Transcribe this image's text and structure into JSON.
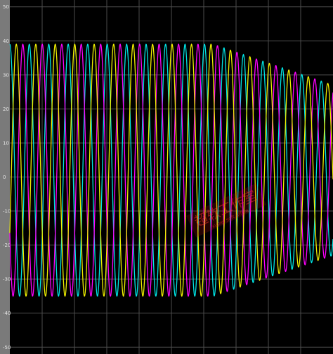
{
  "chart_data": {
    "type": "line",
    "title": "",
    "xlabel": "",
    "ylabel": "",
    "ylim": [
      -52,
      52
    ],
    "yticks": [
      -50,
      -40,
      -30,
      -20,
      -10,
      0,
      10,
      20,
      30,
      40,
      50
    ],
    "ytick_labels": [
      "-50",
      "-40",
      "-30",
      "-20",
      "-10",
      "0",
      "10",
      "20",
      "30",
      "40",
      "50"
    ],
    "grid": true,
    "background": "#000000",
    "grid_color": "#4d4d4d",
    "axis_color": "#a6a6a6",
    "cycles_visible": 16.6,
    "series": [
      {
        "color": "#00e5e5",
        "phase_cycles": 0.0,
        "amplitude_start": 37,
        "amplitude_end": 25,
        "offset": 2,
        "envelope_drop_at": 0.63
      },
      {
        "color": "#ff00ff",
        "phase_cycles": 0.667,
        "amplitude_start": 37,
        "amplitude_end": 25,
        "offset": 2,
        "envelope_drop_at": 0.63
      },
      {
        "color": "#f0f000",
        "phase_cycles": 0.333,
        "amplitude_start": 37,
        "amplitude_end": 25,
        "offset": 2,
        "envelope_drop_at": 0.63
      }
    ],
    "watermark": {
      "text_main": "超软工作室",
      "text_sub": "xuper soft office",
      "color": "#ff2a2a"
    }
  }
}
